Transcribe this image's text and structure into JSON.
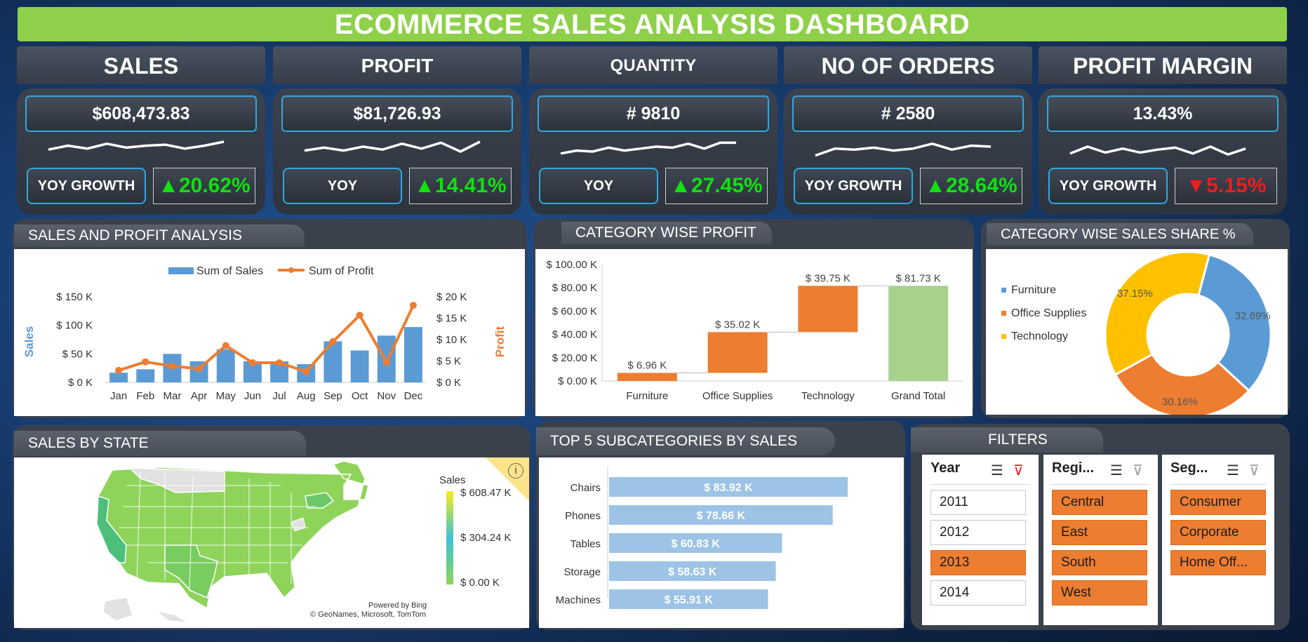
{
  "title": "ECOMMERCE SALES ANALYSIS DASHBOARD",
  "colors": {
    "accent_green": "#8ed04a",
    "sales_blue": "#5b9bd5",
    "profit_orange": "#ed7d31",
    "growth_up": "#12e012",
    "growth_down": "#ee1d1d"
  },
  "kpis": [
    {
      "label": "SALES",
      "value": "$608,473.83",
      "yoy_label": "YOY GROWTH",
      "growth": "▲20.62%",
      "direction": "up"
    },
    {
      "label": "PROFIT",
      "value": "$81,726.93",
      "yoy_label": "YOY",
      "growth": "▲14.41%",
      "direction": "up"
    },
    {
      "label": "QUANTITY",
      "value": "# 9810",
      "yoy_label": "YOY",
      "growth": "▲27.45%",
      "direction": "up"
    },
    {
      "label": "NO OF ORDERS",
      "value": "# 2580",
      "yoy_label": "YOY GROWTH",
      "growth": "▲28.64%",
      "direction": "up"
    },
    {
      "label": "PROFIT MARGIN",
      "value": "13.43%",
      "yoy_label": "YOY GROWTH",
      "growth": "▼5.15%",
      "direction": "down"
    }
  ],
  "sales_profit": {
    "title": "SALES AND PROFIT ANALYSIS",
    "legend_sales": "Sum of Sales",
    "legend_profit": "Sum of Profit",
    "ylabel_left": "Sales",
    "ylabel_right": "Profit",
    "left_ticks": [
      "$ 0 K",
      "$ 50 K",
      "$ 100 K",
      "$ 150 K"
    ],
    "right_ticks": [
      "$ 0 K",
      "$ 5 K",
      "$ 10 K",
      "$ 15 K",
      "$ 20 K"
    ]
  },
  "category_profit": {
    "title": "CATEGORY WISE PROFIT",
    "y_ticks": [
      "$ 0.00 K",
      "$ 20.00 K",
      "$ 40.00 K",
      "$ 60.00 K",
      "$ 80.00 K",
      "$ 100.00 K"
    ]
  },
  "category_share": {
    "title": "CATEGORY WISE SALES SHARE %"
  },
  "state": {
    "title": "SALES BY STATE",
    "legend_title": "Sales",
    "legend_max": "$ 608.47 K",
    "legend_mid": "$ 304.24 K",
    "legend_min": "$ 0.00 K",
    "credit1": "Powered by Bing",
    "credit2": "© GeoNames, Microsoft, TomTom",
    "info_icon": "i"
  },
  "top5": {
    "title": "TOP 5 SUBCATEGORIES BY SALES"
  },
  "filters": {
    "title": "FILTERS",
    "year": {
      "label": "Year",
      "items": [
        "2011",
        "2012",
        "2013",
        "2014"
      ],
      "selected": [
        false,
        false,
        true,
        false
      ]
    },
    "region": {
      "label": "Regi...",
      "items": [
        "Central",
        "East",
        "South",
        "West"
      ],
      "selected": [
        true,
        true,
        true,
        true
      ]
    },
    "segment": {
      "label": "Seg...",
      "items": [
        "Consumer",
        "Corporate",
        "Home Off..."
      ],
      "selected": [
        true,
        true,
        true
      ]
    }
  },
  "chart_data": [
    {
      "type": "bar",
      "title": "SALES AND PROFIT ANALYSIS",
      "categories": [
        "Jan",
        "Feb",
        "Mar",
        "Apr",
        "May",
        "Jun",
        "Jul",
        "Aug",
        "Sep",
        "Oct",
        "Nov",
        "Dec"
      ],
      "series": [
        {
          "name": "Sum of Sales",
          "kind": "bar",
          "axis": "left",
          "values": [
            17,
            23,
            50,
            37,
            58,
            37,
            37,
            32,
            72,
            56,
            82,
            97
          ]
        },
        {
          "name": "Sum of Profit",
          "kind": "line",
          "axis": "right",
          "values": [
            2.8,
            4.8,
            3.8,
            3.2,
            8.6,
            4.6,
            4.6,
            2.5,
            9.5,
            15.7,
            4.7,
            18.0
          ]
        }
      ],
      "ylim_left": [
        0,
        150
      ],
      "ylim_right": [
        0,
        20
      ],
      "xlabel": "",
      "ylabel": "Sales",
      "y2label": "Profit",
      "legend": "top"
    },
    {
      "type": "bar",
      "subtype": "waterfall",
      "title": "CATEGORY WISE PROFIT",
      "categories": [
        "Furniture",
        "Office Supplies",
        "Technology",
        "Grand Total"
      ],
      "values": [
        6.96,
        35.02,
        39.75,
        81.73
      ],
      "labels": [
        "$ 6.96 K",
        "$ 35.02 K",
        "$ 39.75 K",
        "$ 81.73 K"
      ],
      "ylim": [
        0,
        100
      ],
      "ylabel": ""
    },
    {
      "type": "pie",
      "subtype": "donut",
      "title": "CATEGORY WISE SALES SHARE %",
      "categories": [
        "Furniture",
        "Office Supplies",
        "Technology"
      ],
      "values": [
        32.69,
        30.16,
        37.15
      ],
      "labels": [
        "32.69%",
        "30.16%",
        "37.15%"
      ],
      "colors": [
        "#5b9bd5",
        "#ed7d31",
        "#ffc000"
      ],
      "legend": "left"
    },
    {
      "type": "bar",
      "orientation": "horizontal",
      "title": "TOP 5 SUBCATEGORIES BY SALES",
      "categories": [
        "Chairs",
        "Phones",
        "Tables",
        "Storage",
        "Machines"
      ],
      "values": [
        83.92,
        78.66,
        60.83,
        58.63,
        55.91
      ],
      "labels": [
        "$ 83.92 K",
        "$ 78.66 K",
        "$ 60.83 K",
        "$ 58.63 K",
        "$ 55.91 K"
      ]
    }
  ]
}
